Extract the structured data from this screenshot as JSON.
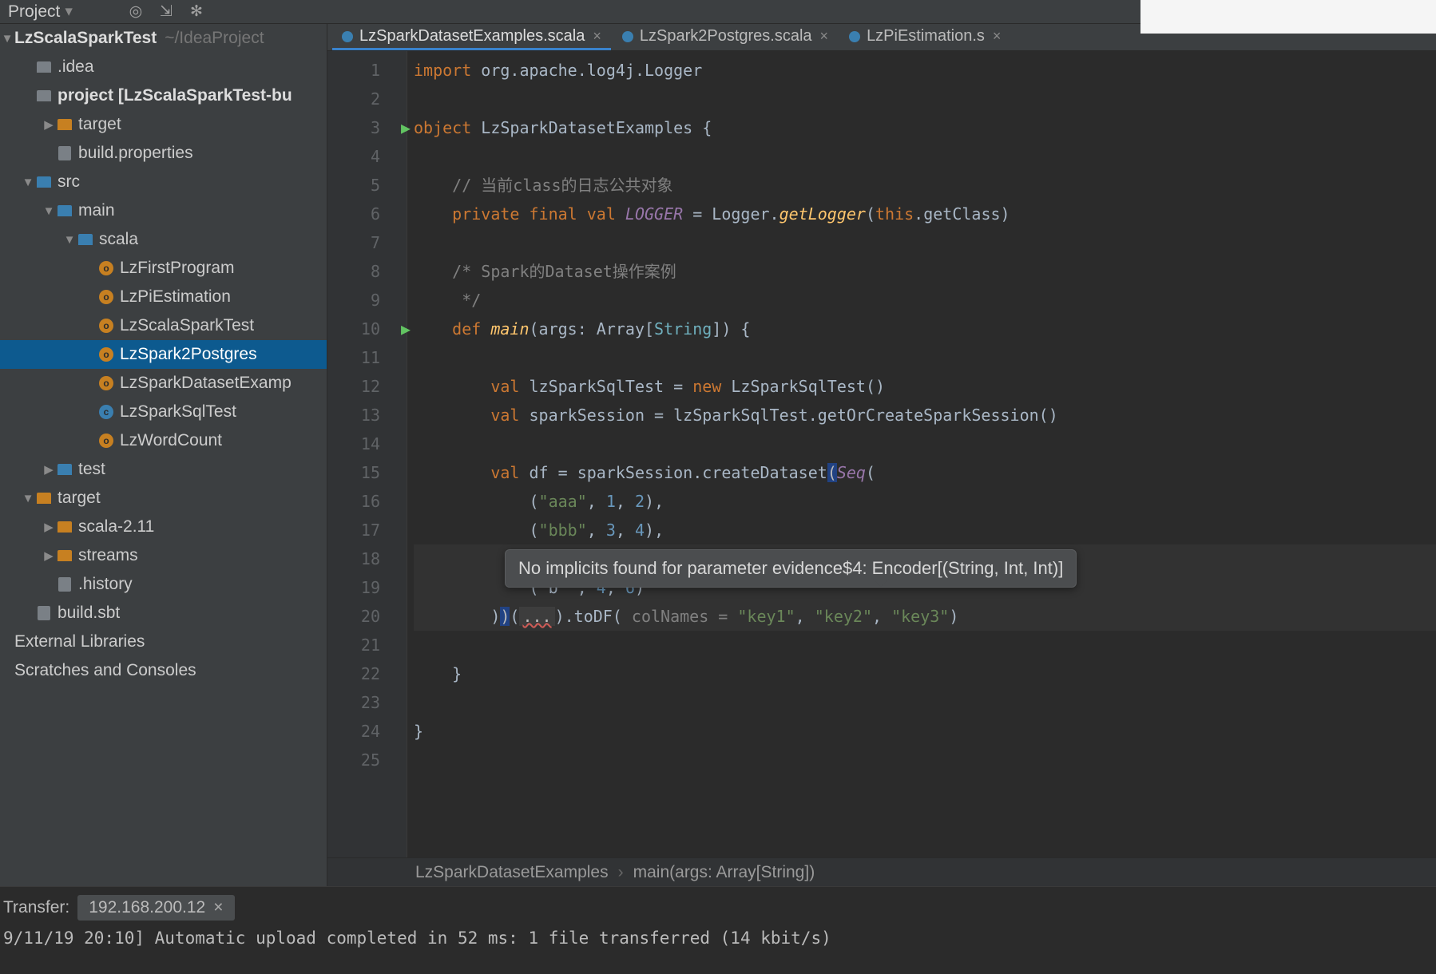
{
  "toolbar": {
    "project_label": "Project"
  },
  "sidebar": {
    "root_name": "LzScalaSparkTest",
    "root_hint": "~/IdeaProject",
    "nodes": [
      {
        "indent": 1,
        "icon": "folder",
        "label": ".idea"
      },
      {
        "indent": 1,
        "icon": "folder",
        "label": "project",
        "suffix": " [LzScalaSparkTest-bu",
        "bold": true
      },
      {
        "indent": 2,
        "arrow": "▶",
        "icon": "folder-o",
        "label": "target"
      },
      {
        "indent": 2,
        "icon": "file",
        "label": "build.properties"
      },
      {
        "indent": 1,
        "arrow": "▼",
        "icon": "folder-b",
        "label": "src"
      },
      {
        "indent": 2,
        "arrow": "▼",
        "icon": "folder-b",
        "label": "main"
      },
      {
        "indent": 3,
        "arrow": "▼",
        "icon": "folder-b",
        "label": "scala"
      },
      {
        "indent": 4,
        "icon": "obj",
        "label": "LzFirstProgram"
      },
      {
        "indent": 4,
        "icon": "obj",
        "label": "LzPiEstimation"
      },
      {
        "indent": 4,
        "icon": "obj",
        "label": "LzScalaSparkTest"
      },
      {
        "indent": 4,
        "icon": "obj",
        "label": "LzSpark2Postgres",
        "selected": true
      },
      {
        "indent": 4,
        "icon": "obj",
        "label": "LzSparkDatasetExamp"
      },
      {
        "indent": 4,
        "icon": "cls",
        "label": "LzSparkSqlTest"
      },
      {
        "indent": 4,
        "icon": "obj",
        "label": "LzWordCount"
      },
      {
        "indent": 2,
        "arrow": "▶",
        "icon": "folder-b",
        "label": "test"
      },
      {
        "indent": 1,
        "arrow": "▼",
        "icon": "folder-o",
        "label": "target"
      },
      {
        "indent": 2,
        "arrow": "▶",
        "icon": "folder-o",
        "label": "scala-2.11"
      },
      {
        "indent": 2,
        "arrow": "▶",
        "icon": "folder-o",
        "label": "streams"
      },
      {
        "indent": 2,
        "icon": "file",
        "label": ".history"
      },
      {
        "indent": 1,
        "icon": "file",
        "label": "build.sbt"
      },
      {
        "indent": 0,
        "icon": "",
        "label": "External Libraries"
      },
      {
        "indent": 0,
        "icon": "",
        "label": "Scratches and Consoles"
      }
    ]
  },
  "tabs": [
    {
      "label": "LzSparkDatasetExamples.scala",
      "active": true
    },
    {
      "label": "LzSpark2Postgres.scala"
    },
    {
      "label": "LzPiEstimation.s"
    }
  ],
  "gutter_lines": 25,
  "run_lines": [
    3,
    10
  ],
  "code": {
    "l1": "import org.apache.log4j.Logger",
    "l3a": "object ",
    "l3b": "LzSparkDatasetExamples {",
    "l5": "    // 当前class的日志公共对象",
    "l6a": "    private final val ",
    "l6b": "LOGGER",
    "l6c": " = Logger.",
    "l6d": "getLogger",
    "l6e": "(",
    "l6f": "this",
    "l6g": ".getClass)",
    "l8": "    /* Spark的Dataset操作案例",
    "l9": "     */",
    "l10a": "    def ",
    "l10b": "main",
    "l10c": "(args: Array[",
    "l10d": "String",
    "l10e": "]) {",
    "l12a": "        val ",
    "l12b": "lzSparkSqlTest = ",
    "l12c": "new ",
    "l12d": "LzSparkSqlTest()",
    "l13a": "        val ",
    "l13b": "sparkSession = lzSparkSqlTest.getOrCreateSparkSession()",
    "l15a": "        val ",
    "l15b": "df = sparkSession.createDataset",
    "l15c": "(",
    "l15d": "Seq",
    "l15e": "(",
    "l16a": "            (",
    "l16b": "\"aaa\"",
    "l16c": ", ",
    "l16d": "1",
    "l16e": ", ",
    "l16f": "2",
    "l16g": "),",
    "l17a": "            (",
    "l17b": "\"bbb\"",
    "l17c": ", ",
    "l17d": "3",
    "l17e": ", ",
    "l17f": "4",
    "l17g": "),",
    "l19a": "            ( b  , ",
    "l19b": "4",
    "l19c": ", ",
    "l19d": "6",
    "l19e": ")",
    "l20a": "        )",
    "l20b": ")",
    "l20c": "(",
    "l20d": "...",
    "l20e": ").toDF(",
    "l20f": " colNames = ",
    "l20g": "\"key1\"",
    "l20h": ", ",
    "l20i": "\"key2\"",
    "l20j": ", ",
    "l20k": "\"key3\"",
    "l20l": ")",
    "l22": "    }",
    "l24": "}"
  },
  "tooltip": "No implicits found for parameter evidence$4: Encoder[(String, Int, Int)]",
  "breadcrumb": {
    "a": "LzSparkDatasetExamples",
    "b": "main(args: Array[String])"
  },
  "console": {
    "label": "Transfer:",
    "host": "192.168.200.12",
    "log": "9/11/19 20:10] Automatic upload completed in 52 ms: 1 file transferred (14 kbit/s)"
  }
}
